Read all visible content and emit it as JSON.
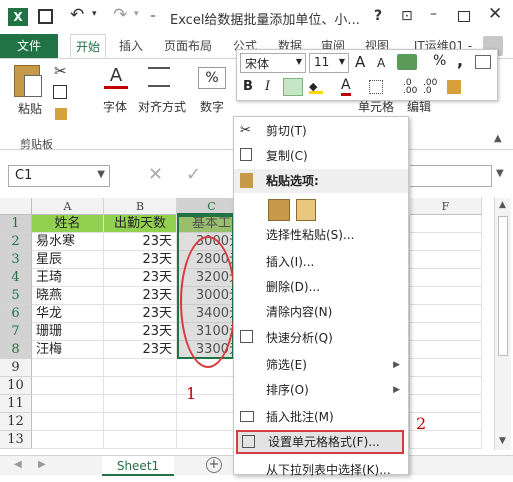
{
  "title_bar": {
    "app_icon": "excel-icon",
    "title": "Excel给数据批量添加单位、小...",
    "help": "?",
    "restore": "⊡",
    "minimize": "–"
  },
  "tabs": [
    {
      "label": "文件"
    },
    {
      "label": "开始"
    },
    {
      "label": "插入"
    },
    {
      "label": "页面布局"
    },
    {
      "label": "公式"
    },
    {
      "label": "数据"
    },
    {
      "label": "审阅"
    },
    {
      "label": "视图"
    },
    {
      "label": "IT运维01 -"
    }
  ],
  "ribbon": {
    "paste": "粘贴",
    "clipboard": "剪贴板",
    "font": "字体",
    "align": "对齐方式",
    "number": "数字",
    "cells": "单元格",
    "edit": "编辑",
    "percent": "%"
  },
  "formula": {
    "namebox": "C1",
    "fx": "fx"
  },
  "columns": [
    "A",
    "B",
    "C",
    "D",
    "E",
    "F"
  ],
  "rows": [
    {
      "n": "1",
      "a": "姓名",
      "b": "出勤天数",
      "c": "基本工"
    },
    {
      "n": "2",
      "a": "易水寒",
      "b": "23天",
      "c": "3000元"
    },
    {
      "n": "3",
      "a": "星辰",
      "b": "23天",
      "c": "2800元"
    },
    {
      "n": "4",
      "a": "王琦",
      "b": "23天",
      "c": "3200元"
    },
    {
      "n": "5",
      "a": "晓燕",
      "b": "23天",
      "c": "3000元"
    },
    {
      "n": "6",
      "a": "华龙",
      "b": "23天",
      "c": "3400元"
    },
    {
      "n": "7",
      "a": "珊珊",
      "b": "23天",
      "c": "3100元"
    },
    {
      "n": "8",
      "a": "汪梅",
      "b": "23天",
      "c": "3300元"
    },
    {
      "n": "9",
      "a": "",
      "b": "",
      "c": ""
    },
    {
      "n": "10",
      "a": "",
      "b": "",
      "c": ""
    },
    {
      "n": "11",
      "a": "",
      "b": "",
      "c": ""
    },
    {
      "n": "12",
      "a": "",
      "b": "",
      "c": ""
    },
    {
      "n": "13",
      "a": "",
      "b": "",
      "c": ""
    }
  ],
  "sheet_tab": "Sheet1",
  "mini_toolbar": {
    "font_name": "宋体",
    "font_size": "11",
    "bold": "B",
    "italic": "I",
    "percent": "%",
    "comma": ",",
    "inc_font": "A",
    "dec_font": "A"
  },
  "context_menu": {
    "cut": "剪切(T)",
    "copy": "复制(C)",
    "paste_opts": "粘贴选项:",
    "paste_special": "选择性粘贴(S)...",
    "insert": "插入(I)...",
    "delete": "删除(D)...",
    "clear": "清除内容(N)",
    "quick": "快速分析(Q)",
    "filter": "筛选(E)",
    "sort": "排序(O)",
    "comment": "插入批注(M)",
    "format_cells": "设置单元格格式(F)...",
    "dropdown": "从下拉列表中选择(K)..."
  },
  "annotations": {
    "one": "1",
    "two": "2"
  },
  "colors": {
    "excel_green": "#217346",
    "header_fill": "#92d050"
  }
}
